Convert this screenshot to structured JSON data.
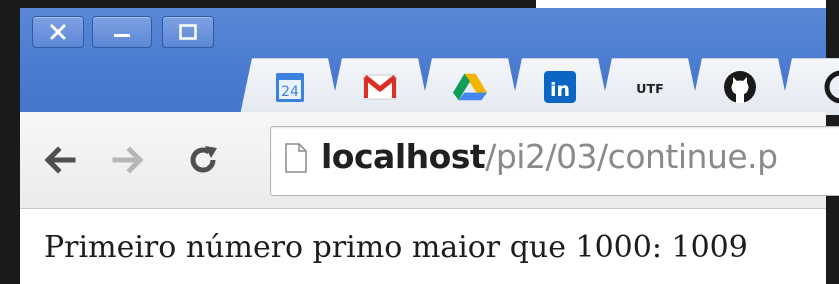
{
  "window_controls": {
    "close_icon": "close-icon",
    "minimize_icon": "minimize-icon",
    "maximize_icon": "maximize-icon"
  },
  "tabs": [
    {
      "name": "google-calendar",
      "icon": "calendar-icon",
      "label": "24"
    },
    {
      "name": "gmail",
      "icon": "gmail-icon",
      "label": "M"
    },
    {
      "name": "google-drive",
      "icon": "drive-icon",
      "label": ""
    },
    {
      "name": "linkedin",
      "icon": "linkedin-icon",
      "label": "in"
    },
    {
      "name": "utfpr",
      "icon": "utfpr-icon",
      "label": "UTF"
    },
    {
      "name": "github",
      "icon": "github-icon",
      "label": ""
    },
    {
      "name": "partial",
      "icon": "partial-tab-icon",
      "label": ""
    }
  ],
  "toolbar": {
    "back_icon": "back-arrow-icon",
    "forward_icon": "forward-arrow-icon",
    "reload_icon": "reload-icon"
  },
  "omnibox": {
    "host": "localhost",
    "path": "/pi2/03/continue.p"
  },
  "page": {
    "text": "Primeiro número primo maior que 1000: 1009"
  },
  "colors": {
    "titlebar": "#4a7bd0",
    "gmail_red": "#d93025",
    "linkedin_blue": "#0a66c2",
    "calendar_blue": "#3b82e0"
  }
}
